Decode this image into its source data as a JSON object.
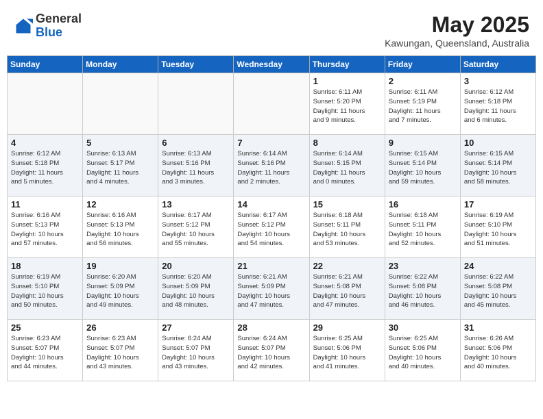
{
  "header": {
    "logo_general": "General",
    "logo_blue": "Blue",
    "month_year": "May 2025",
    "location": "Kawungan, Queensland, Australia"
  },
  "days_of_week": [
    "Sunday",
    "Monday",
    "Tuesday",
    "Wednesday",
    "Thursday",
    "Friday",
    "Saturday"
  ],
  "weeks": [
    [
      {
        "day": "",
        "info": ""
      },
      {
        "day": "",
        "info": ""
      },
      {
        "day": "",
        "info": ""
      },
      {
        "day": "",
        "info": ""
      },
      {
        "day": "1",
        "info": "Sunrise: 6:11 AM\nSunset: 5:20 PM\nDaylight: 11 hours\nand 9 minutes."
      },
      {
        "day": "2",
        "info": "Sunrise: 6:11 AM\nSunset: 5:19 PM\nDaylight: 11 hours\nand 7 minutes."
      },
      {
        "day": "3",
        "info": "Sunrise: 6:12 AM\nSunset: 5:18 PM\nDaylight: 11 hours\nand 6 minutes."
      }
    ],
    [
      {
        "day": "4",
        "info": "Sunrise: 6:12 AM\nSunset: 5:18 PM\nDaylight: 11 hours\nand 5 minutes."
      },
      {
        "day": "5",
        "info": "Sunrise: 6:13 AM\nSunset: 5:17 PM\nDaylight: 11 hours\nand 4 minutes."
      },
      {
        "day": "6",
        "info": "Sunrise: 6:13 AM\nSunset: 5:16 PM\nDaylight: 11 hours\nand 3 minutes."
      },
      {
        "day": "7",
        "info": "Sunrise: 6:14 AM\nSunset: 5:16 PM\nDaylight: 11 hours\nand 2 minutes."
      },
      {
        "day": "8",
        "info": "Sunrise: 6:14 AM\nSunset: 5:15 PM\nDaylight: 11 hours\nand 0 minutes."
      },
      {
        "day": "9",
        "info": "Sunrise: 6:15 AM\nSunset: 5:14 PM\nDaylight: 10 hours\nand 59 minutes."
      },
      {
        "day": "10",
        "info": "Sunrise: 6:15 AM\nSunset: 5:14 PM\nDaylight: 10 hours\nand 58 minutes."
      }
    ],
    [
      {
        "day": "11",
        "info": "Sunrise: 6:16 AM\nSunset: 5:13 PM\nDaylight: 10 hours\nand 57 minutes."
      },
      {
        "day": "12",
        "info": "Sunrise: 6:16 AM\nSunset: 5:13 PM\nDaylight: 10 hours\nand 56 minutes."
      },
      {
        "day": "13",
        "info": "Sunrise: 6:17 AM\nSunset: 5:12 PM\nDaylight: 10 hours\nand 55 minutes."
      },
      {
        "day": "14",
        "info": "Sunrise: 6:17 AM\nSunset: 5:12 PM\nDaylight: 10 hours\nand 54 minutes."
      },
      {
        "day": "15",
        "info": "Sunrise: 6:18 AM\nSunset: 5:11 PM\nDaylight: 10 hours\nand 53 minutes."
      },
      {
        "day": "16",
        "info": "Sunrise: 6:18 AM\nSunset: 5:11 PM\nDaylight: 10 hours\nand 52 minutes."
      },
      {
        "day": "17",
        "info": "Sunrise: 6:19 AM\nSunset: 5:10 PM\nDaylight: 10 hours\nand 51 minutes."
      }
    ],
    [
      {
        "day": "18",
        "info": "Sunrise: 6:19 AM\nSunset: 5:10 PM\nDaylight: 10 hours\nand 50 minutes."
      },
      {
        "day": "19",
        "info": "Sunrise: 6:20 AM\nSunset: 5:09 PM\nDaylight: 10 hours\nand 49 minutes."
      },
      {
        "day": "20",
        "info": "Sunrise: 6:20 AM\nSunset: 5:09 PM\nDaylight: 10 hours\nand 48 minutes."
      },
      {
        "day": "21",
        "info": "Sunrise: 6:21 AM\nSunset: 5:09 PM\nDaylight: 10 hours\nand 47 minutes."
      },
      {
        "day": "22",
        "info": "Sunrise: 6:21 AM\nSunset: 5:08 PM\nDaylight: 10 hours\nand 47 minutes."
      },
      {
        "day": "23",
        "info": "Sunrise: 6:22 AM\nSunset: 5:08 PM\nDaylight: 10 hours\nand 46 minutes."
      },
      {
        "day": "24",
        "info": "Sunrise: 6:22 AM\nSunset: 5:08 PM\nDaylight: 10 hours\nand 45 minutes."
      }
    ],
    [
      {
        "day": "25",
        "info": "Sunrise: 6:23 AM\nSunset: 5:07 PM\nDaylight: 10 hours\nand 44 minutes."
      },
      {
        "day": "26",
        "info": "Sunrise: 6:23 AM\nSunset: 5:07 PM\nDaylight: 10 hours\nand 43 minutes."
      },
      {
        "day": "27",
        "info": "Sunrise: 6:24 AM\nSunset: 5:07 PM\nDaylight: 10 hours\nand 43 minutes."
      },
      {
        "day": "28",
        "info": "Sunrise: 6:24 AM\nSunset: 5:07 PM\nDaylight: 10 hours\nand 42 minutes."
      },
      {
        "day": "29",
        "info": "Sunrise: 6:25 AM\nSunset: 5:06 PM\nDaylight: 10 hours\nand 41 minutes."
      },
      {
        "day": "30",
        "info": "Sunrise: 6:25 AM\nSunset: 5:06 PM\nDaylight: 10 hours\nand 40 minutes."
      },
      {
        "day": "31",
        "info": "Sunrise: 6:26 AM\nSunset: 5:06 PM\nDaylight: 10 hours\nand 40 minutes."
      }
    ]
  ]
}
